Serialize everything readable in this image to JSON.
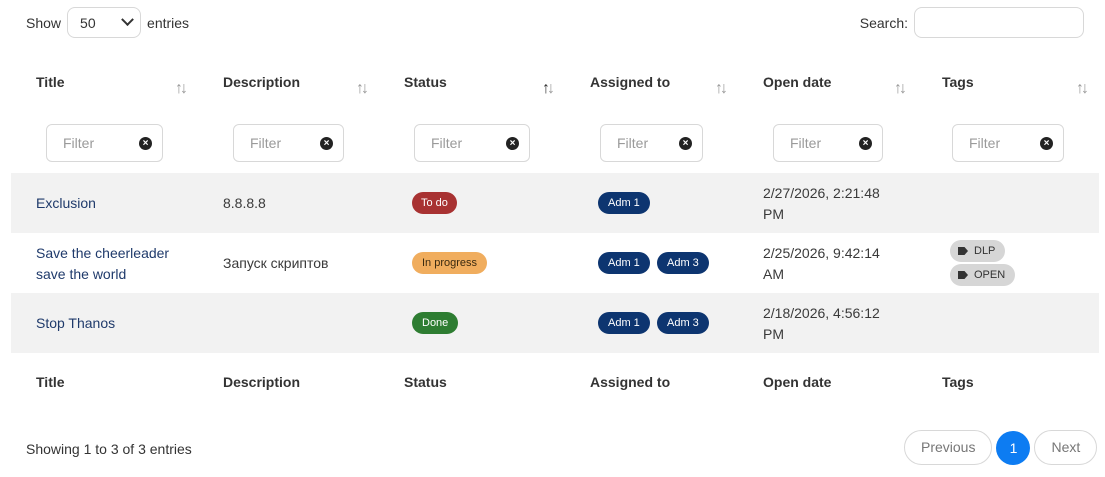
{
  "length_menu": {
    "show_label": "Show",
    "value": "50",
    "entries_label": "entries"
  },
  "search": {
    "label": "Search:",
    "value": ""
  },
  "columns": [
    "Title",
    "Description",
    "Status",
    "Assigned to",
    "Open date",
    "Tags"
  ],
  "filter_placeholder": "Filter",
  "rows": [
    {
      "title": "Exclusion",
      "description": "8.8.8.8",
      "status": "To do",
      "assigned": [
        "Adm 1"
      ],
      "open_date": "2/27/2026, 2:21:48 PM",
      "tags": []
    },
    {
      "title": "Save the cheerleader save the world",
      "description": "Запуск скриптов",
      "status": "In progress",
      "assigned": [
        "Adm 1",
        "Adm 3"
      ],
      "open_date": "2/25/2026, 9:42:14 AM",
      "tags": [
        "DLP",
        "OPEN"
      ]
    },
    {
      "title": "Stop Thanos",
      "description": "",
      "status": "Done",
      "assigned": [
        "Adm 1",
        "Adm 3"
      ],
      "open_date": "2/18/2026, 4:56:12 PM",
      "tags": []
    }
  ],
  "status_colors": {
    "To do": "#a83232",
    "In progress": "#f0ad5e",
    "Done": "#2e7d32"
  },
  "assignee_color": "#0d3570",
  "footer_info": "Showing 1 to 3 of 3 entries",
  "pagination": {
    "previous": "Previous",
    "current": "1",
    "next": "Next"
  }
}
